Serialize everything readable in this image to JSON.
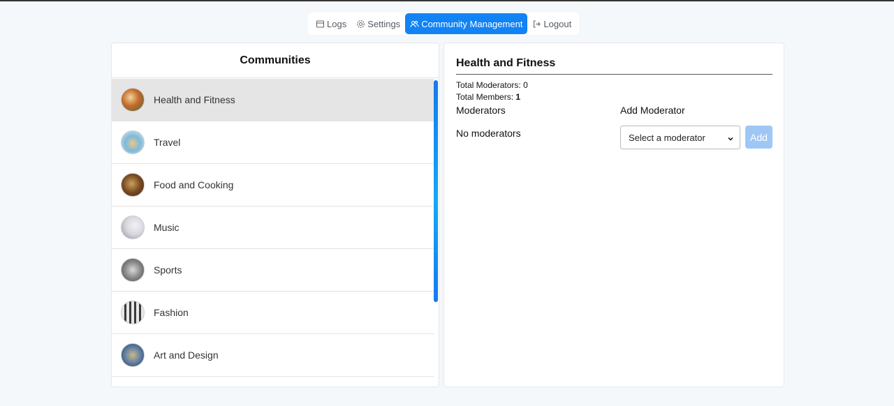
{
  "nav": {
    "items": [
      {
        "label": "Logs",
        "icon": "logs-icon",
        "active": false
      },
      {
        "label": "Settings",
        "icon": "gear-icon",
        "active": false
      },
      {
        "label": "Community Management",
        "icon": "users-icon",
        "active": true
      },
      {
        "label": "Logout",
        "icon": "logout-icon",
        "active": false
      }
    ]
  },
  "communities": {
    "title": "Communities",
    "items": [
      {
        "name": "Health and Fitness",
        "selected": true
      },
      {
        "name": "Travel",
        "selected": false
      },
      {
        "name": "Food and Cooking",
        "selected": false
      },
      {
        "name": "Music",
        "selected": false
      },
      {
        "name": "Sports",
        "selected": false
      },
      {
        "name": "Fashion",
        "selected": false
      },
      {
        "name": "Art and Design",
        "selected": false
      }
    ]
  },
  "detail": {
    "title": "Health and Fitness",
    "total_moderators_label": "Total Moderators:",
    "total_moderators_value": "0",
    "total_members_label": "Total Members:",
    "total_members_value": "1",
    "moderators_heading": "Moderators",
    "add_moderator_heading": "Add Moderator",
    "no_moderators_text": "No moderators",
    "select_placeholder": "Select a moderator",
    "add_button_label": "Add"
  },
  "colors": {
    "accent": "#1283f4",
    "add_button_disabled": "#9fc7f6",
    "selected_row": "#e5e5e5"
  }
}
